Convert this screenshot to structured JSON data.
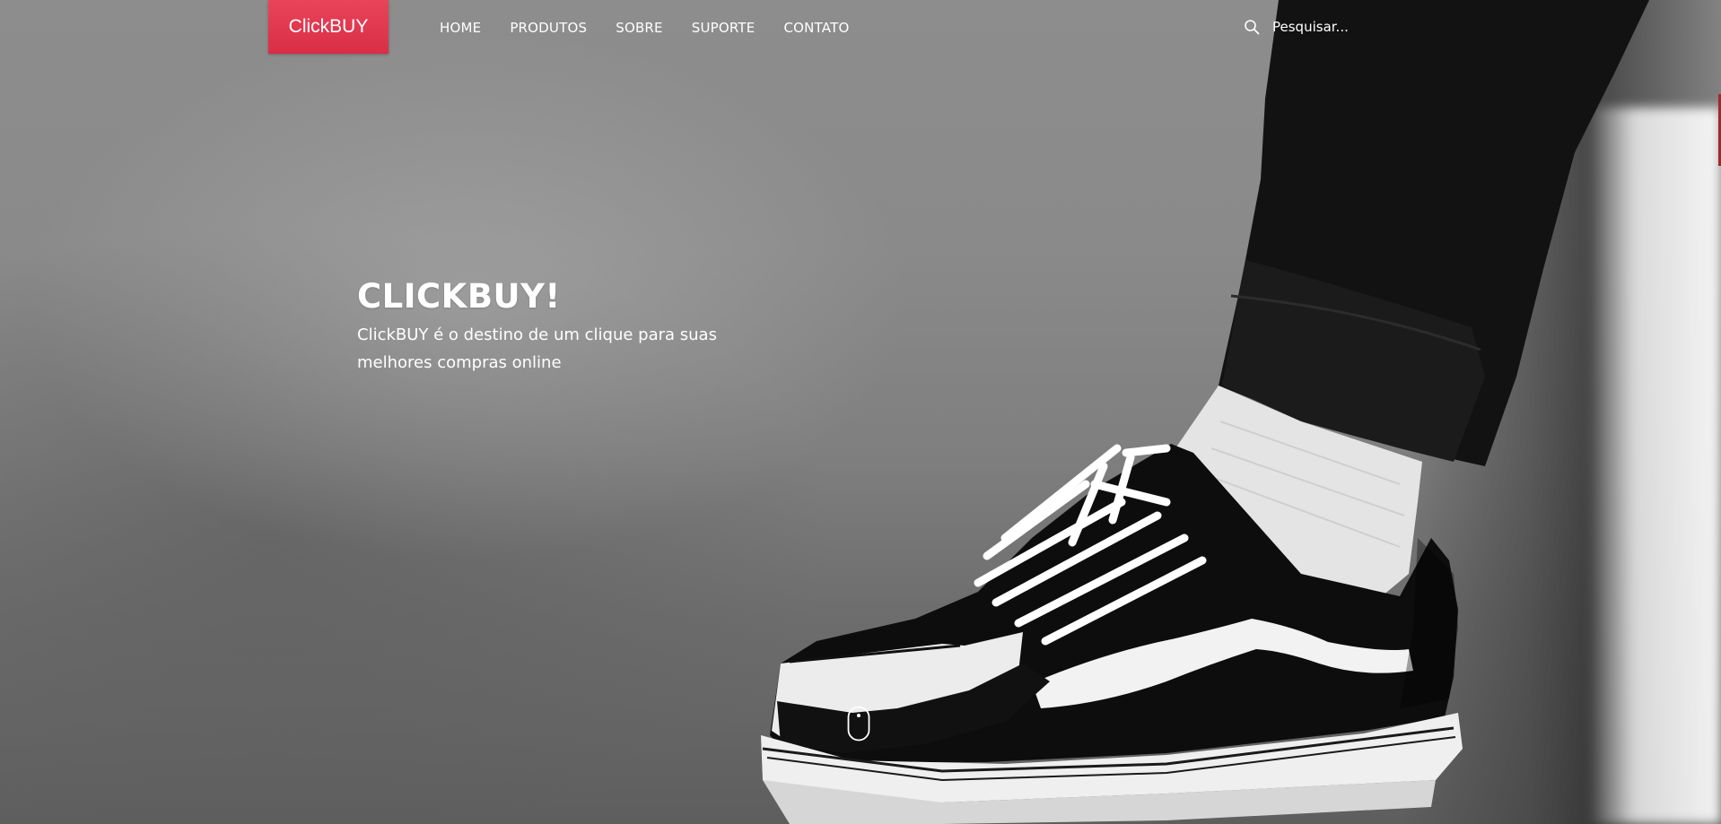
{
  "brand": {
    "name": "ClickBUY",
    "accent_color": "#e0384f"
  },
  "nav": {
    "items": [
      {
        "label": "HOME"
      },
      {
        "label": "PRODUTOS"
      },
      {
        "label": "SOBRE"
      },
      {
        "label": "SUPORTE"
      },
      {
        "label": "CONTATO"
      }
    ]
  },
  "search": {
    "icon": "search-icon",
    "placeholder": "Pesquisar..."
  },
  "hero": {
    "title": "CLICKBUY!",
    "subtitle": "ClickBUY é o destino de um clique para suas melhores compras online",
    "scroll_icon": "mouse-scroll-icon"
  }
}
